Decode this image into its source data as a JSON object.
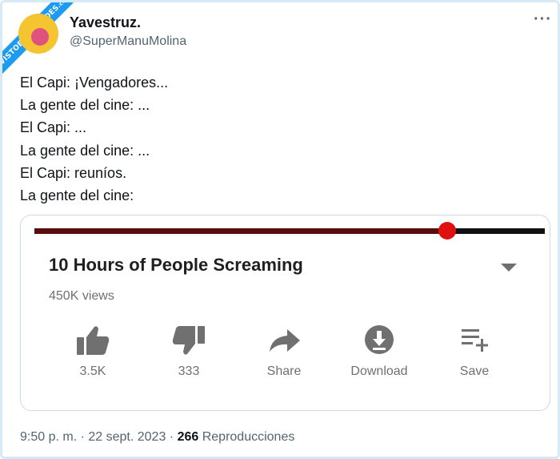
{
  "watermark": {
    "text": "VISTOENLASREDES",
    "suffix": ".com"
  },
  "author": {
    "display_name": "Yavestruz.",
    "handle": "@SuperManuMolina",
    "more_label": "···"
  },
  "tweet": {
    "lines": [
      "El Capi: ¡Vengadores...",
      "La gente del cine: ...",
      "El Capi: ...",
      "La gente del cine: ...",
      "El Capi: reuníos.",
      "La gente del cine:"
    ]
  },
  "video_card": {
    "progress": 0.808,
    "progress_color": "#e01010",
    "title": "10 Hours of People Screaming",
    "views": "450K views",
    "actions": [
      {
        "icon": "thumbs-up-icon",
        "label": "3.5K"
      },
      {
        "icon": "thumbs-down-icon",
        "label": "333"
      },
      {
        "icon": "share-arrow-icon",
        "label": "Share"
      },
      {
        "icon": "download-icon",
        "label": "Download"
      },
      {
        "icon": "playlist-add-icon",
        "label": "Save"
      }
    ]
  },
  "footer": {
    "time": "9:50 p. m.",
    "separator1": " · ",
    "date": "22 sept. 2023",
    "separator2": " · ",
    "views_count": "266",
    "views_label": " Reproducciones"
  }
}
